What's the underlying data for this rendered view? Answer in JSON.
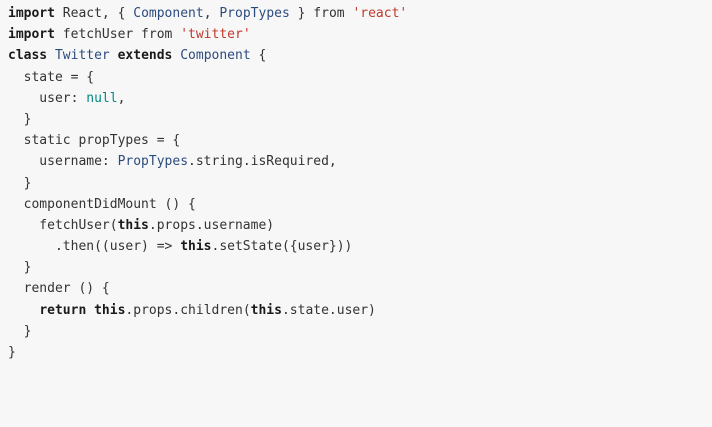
{
  "code": {
    "language": "javascript",
    "lines": [
      [
        {
          "t": "import",
          "c": "kw"
        },
        {
          "t": " React, { ",
          "c": "txt"
        },
        {
          "t": "Component",
          "c": "type"
        },
        {
          "t": ", ",
          "c": "txt"
        },
        {
          "t": "PropTypes",
          "c": "type"
        },
        {
          "t": " } from ",
          "c": "txt"
        },
        {
          "t": "'react'",
          "c": "str"
        }
      ],
      [
        {
          "t": "import",
          "c": "kw"
        },
        {
          "t": " fetchUser from ",
          "c": "txt"
        },
        {
          "t": "'twitter'",
          "c": "str"
        }
      ],
      [
        {
          "t": "class",
          "c": "kw"
        },
        {
          "t": " ",
          "c": "txt"
        },
        {
          "t": "Twitter",
          "c": "type"
        },
        {
          "t": " ",
          "c": "txt"
        },
        {
          "t": "extends",
          "c": "kw"
        },
        {
          "t": " ",
          "c": "txt"
        },
        {
          "t": "Component",
          "c": "type"
        },
        {
          "t": " {",
          "c": "txt"
        }
      ],
      [
        {
          "t": "  state = {",
          "c": "txt"
        }
      ],
      [
        {
          "t": "    user: ",
          "c": "txt"
        },
        {
          "t": "null",
          "c": "lit"
        },
        {
          "t": ",",
          "c": "txt"
        }
      ],
      [
        {
          "t": "  }",
          "c": "txt"
        }
      ],
      [
        {
          "t": "  static propTypes = {",
          "c": "txt"
        }
      ],
      [
        {
          "t": "    username: ",
          "c": "txt"
        },
        {
          "t": "PropTypes",
          "c": "type"
        },
        {
          "t": ".string.isRequired,",
          "c": "txt"
        }
      ],
      [
        {
          "t": "  }",
          "c": "txt"
        }
      ],
      [
        {
          "t": "  componentDidMount () {",
          "c": "txt"
        }
      ],
      [
        {
          "t": "    fetchUser(",
          "c": "txt"
        },
        {
          "t": "this",
          "c": "kw"
        },
        {
          "t": ".props.username)",
          "c": "txt"
        }
      ],
      [
        {
          "t": "      .then((user) => ",
          "c": "txt"
        },
        {
          "t": "this",
          "c": "kw"
        },
        {
          "t": ".setState({user}))",
          "c": "txt"
        }
      ],
      [
        {
          "t": "  }",
          "c": "txt"
        }
      ],
      [
        {
          "t": "  render () {",
          "c": "txt"
        }
      ],
      [
        {
          "t": "    ",
          "c": "txt"
        },
        {
          "t": "return",
          "c": "kw"
        },
        {
          "t": " ",
          "c": "txt"
        },
        {
          "t": "this",
          "c": "kw"
        },
        {
          "t": ".props.children(",
          "c": "txt"
        },
        {
          "t": "this",
          "c": "kw"
        },
        {
          "t": ".state.user)",
          "c": "txt"
        }
      ],
      [
        {
          "t": "  }",
          "c": "txt"
        }
      ],
      [
        {
          "t": "}",
          "c": "txt"
        }
      ]
    ]
  }
}
